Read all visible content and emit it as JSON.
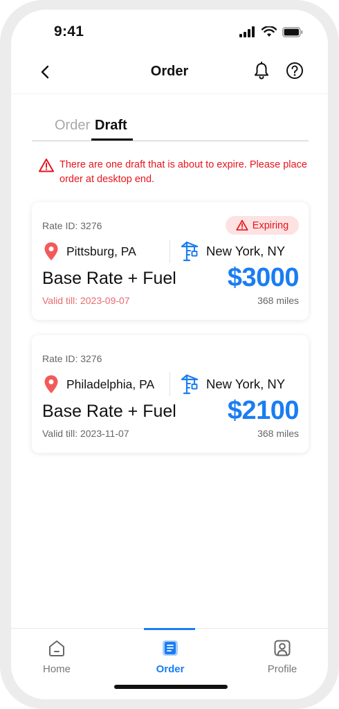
{
  "status_bar": {
    "time": "9:41"
  },
  "header": {
    "title": "Order"
  },
  "tabs": [
    {
      "label": "Order",
      "active": false
    },
    {
      "label": "Draft",
      "active": true
    }
  ],
  "warning": {
    "text": "There are one draft that is about to expire. Please place order at desktop end."
  },
  "cards": [
    {
      "rate_id_label": "Rate ID:",
      "rate_id": "3276",
      "badge": "Expiring",
      "origin": "Pittsburg, PA",
      "destination": "New York, NY",
      "rate_type": "Base Rate + Fuel",
      "price": "$3000",
      "valid_label": "Valid till:",
      "valid_date": "2023-09-07",
      "miles": "368 miles"
    },
    {
      "rate_id_label": "Rate ID:",
      "rate_id": "3276",
      "origin": "Philadelphia, PA",
      "destination": "New York, NY",
      "rate_type": "Base Rate + Fuel",
      "price": "$2100",
      "valid_label": "Valid till:",
      "valid_date": "2023-11-07",
      "miles": "368 miles"
    }
  ],
  "bottom_nav": [
    {
      "label": "Home",
      "icon": "home-icon",
      "active": false
    },
    {
      "label": "Order",
      "icon": "order-icon",
      "active": true
    },
    {
      "label": "Profile",
      "icon": "profile-icon",
      "active": false
    }
  ],
  "colors": {
    "accent": "#1a7df2",
    "danger": "#e8141b",
    "badge_bg": "#fde2e2",
    "expired_date": "#e86a6a"
  }
}
